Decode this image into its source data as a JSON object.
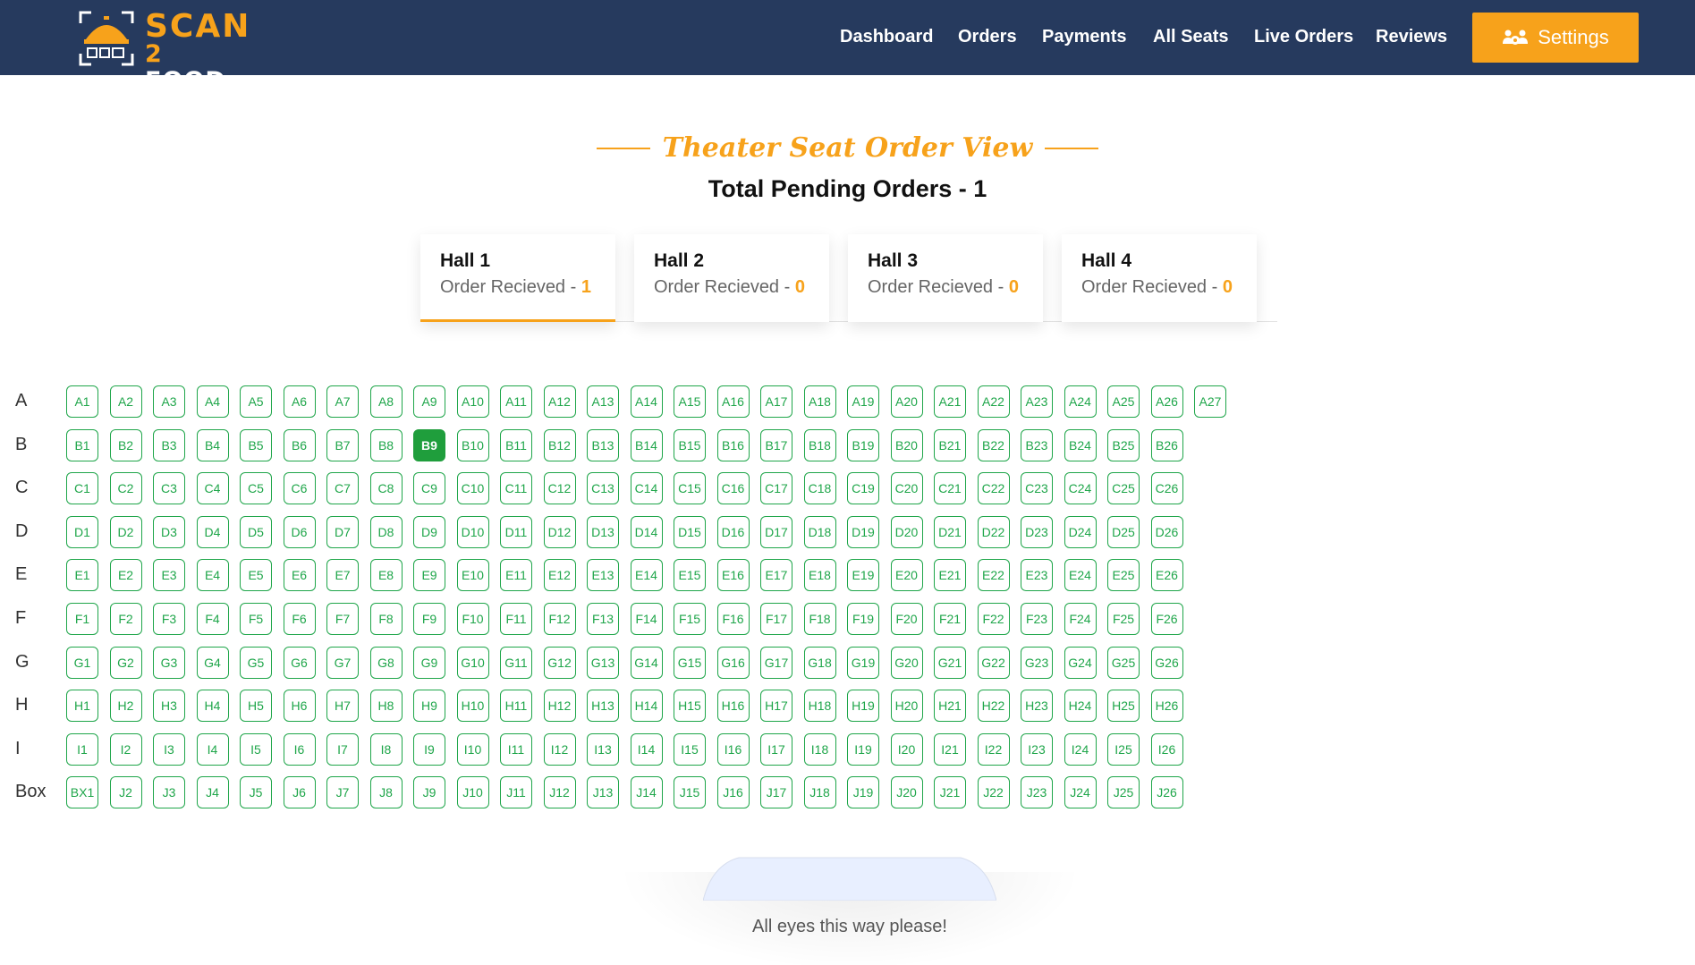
{
  "brand": {
    "name_line1": "SCAN",
    "name_line2_number": "2",
    "name_line2_word": "FOOD",
    "primary_color": "#263a5e",
    "accent_color": "#f7a21b"
  },
  "nav": {
    "items": [
      {
        "label": "Dashboard"
      },
      {
        "label": "Orders"
      },
      {
        "label": "Payments"
      },
      {
        "label": "All Seats"
      },
      {
        "label": "Live Orders"
      },
      {
        "label": "Reviews"
      }
    ],
    "settings_label": "Settings",
    "settings_icon": "users-cog-icon"
  },
  "page": {
    "title": "Theater Seat Order View",
    "pending_label": "Total Pending Orders - 1"
  },
  "halls": [
    {
      "name": "Hall 1",
      "order_label": "Order Recieved - ",
      "count": "1",
      "active": true
    },
    {
      "name": "Hall 2",
      "order_label": "Order Recieved - ",
      "count": "0",
      "active": false
    },
    {
      "name": "Hall 3",
      "order_label": "Order Recieved - ",
      "count": "0",
      "active": false
    },
    {
      "name": "Hall 4",
      "order_label": "Order Recieved - ",
      "count": "0",
      "active": false
    }
  ],
  "seat_rows": [
    {
      "label": "A",
      "seats": [
        "A1",
        "A2",
        "A3",
        "A4",
        "A5",
        "A6",
        "A7",
        "A8",
        "A9",
        "A10",
        "A11",
        "A12",
        "A13",
        "A14",
        "A15",
        "A16",
        "A17",
        "A18",
        "A19",
        "A20",
        "A21",
        "A22",
        "A23",
        "A24",
        "A25",
        "A26",
        "A27"
      ]
    },
    {
      "label": "B",
      "seats": [
        "B1",
        "B2",
        "B3",
        "B4",
        "B5",
        "B6",
        "B7",
        "B8",
        "B9",
        "B10",
        "B11",
        "B12",
        "B13",
        "B14",
        "B15",
        "B16",
        "B17",
        "B18",
        "B19",
        "B20",
        "B21",
        "B22",
        "B23",
        "B24",
        "B25",
        "B26"
      ]
    },
    {
      "label": "C",
      "seats": [
        "C1",
        "C2",
        "C3",
        "C4",
        "C5",
        "C6",
        "C7",
        "C8",
        "C9",
        "C10",
        "C11",
        "C12",
        "C13",
        "C14",
        "C15",
        "C16",
        "C17",
        "C18",
        "C19",
        "C20",
        "C21",
        "C22",
        "C23",
        "C24",
        "C25",
        "C26"
      ]
    },
    {
      "label": "D",
      "seats": [
        "D1",
        "D2",
        "D3",
        "D4",
        "D5",
        "D6",
        "D7",
        "D8",
        "D9",
        "D10",
        "D11",
        "D12",
        "D13",
        "D14",
        "D15",
        "D16",
        "D17",
        "D18",
        "D19",
        "D20",
        "D21",
        "D22",
        "D23",
        "D24",
        "D25",
        "D26"
      ]
    },
    {
      "label": "E",
      "seats": [
        "E1",
        "E2",
        "E3",
        "E4",
        "E5",
        "E6",
        "E7",
        "E8",
        "E9",
        "E10",
        "E11",
        "E12",
        "E13",
        "E14",
        "E15",
        "E16",
        "E17",
        "E18",
        "E19",
        "E20",
        "E21",
        "E22",
        "E23",
        "E24",
        "E25",
        "E26"
      ]
    },
    {
      "label": "F",
      "seats": [
        "F1",
        "F2",
        "F3",
        "F4",
        "F5",
        "F6",
        "F7",
        "F8",
        "F9",
        "F10",
        "F11",
        "F12",
        "F13",
        "F14",
        "F15",
        "F16",
        "F17",
        "F18",
        "F19",
        "F20",
        "F21",
        "F22",
        "F23",
        "F24",
        "F25",
        "F26"
      ]
    },
    {
      "label": "G",
      "seats": [
        "G1",
        "G2",
        "G3",
        "G4",
        "G5",
        "G6",
        "G7",
        "G8",
        "G9",
        "G10",
        "G11",
        "G12",
        "G13",
        "G14",
        "G15",
        "G16",
        "G17",
        "G18",
        "G19",
        "G20",
        "G21",
        "G22",
        "G23",
        "G24",
        "G25",
        "G26"
      ]
    },
    {
      "label": "H",
      "seats": [
        "H1",
        "H2",
        "H3",
        "H4",
        "H5",
        "H6",
        "H7",
        "H8",
        "H9",
        "H10",
        "H11",
        "H12",
        "H13",
        "H14",
        "H15",
        "H16",
        "H17",
        "H18",
        "H19",
        "H20",
        "H21",
        "H22",
        "H23",
        "H24",
        "H25",
        "H26"
      ]
    },
    {
      "label": "I",
      "seats": [
        "I1",
        "I2",
        "I3",
        "I4",
        "I5",
        "I6",
        "I7",
        "I8",
        "I9",
        "I10",
        "I11",
        "I12",
        "I13",
        "I14",
        "I15",
        "I16",
        "I17",
        "I18",
        "I19",
        "I20",
        "I21",
        "I22",
        "I23",
        "I24",
        "I25",
        "I26"
      ]
    },
    {
      "label": "Box",
      "seats": [
        "BX1",
        "J2",
        "J3",
        "J4",
        "J5",
        "J6",
        "J7",
        "J8",
        "J9",
        "J10",
        "J11",
        "J12",
        "J13",
        "J14",
        "J15",
        "J16",
        "J17",
        "J18",
        "J19",
        "J20",
        "J21",
        "J22",
        "J23",
        "J24",
        "J25",
        "J26"
      ]
    }
  ],
  "occupied_seats": [
    "B9"
  ],
  "seat_colors": {
    "available": "#1fa64a",
    "occupied": "#1f9e3c"
  },
  "screen": {
    "caption": "All eyes this way please!"
  }
}
